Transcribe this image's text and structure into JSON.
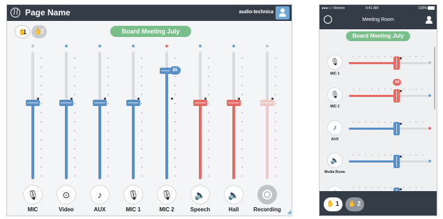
{
  "tablet": {
    "title": "Page Name",
    "brand": "audio-technica",
    "presets": [
      {
        "label": "1",
        "active": true,
        "icon": "hand-icon"
      },
      {
        "label": "2",
        "active": false,
        "icon": "hand-icon"
      }
    ],
    "meeting": "Board Meeting July",
    "channels": [
      {
        "label": "MIC",
        "icon": "microphone-icon",
        "glyph": "🎙",
        "color": "#5a8fc7",
        "led": "#c0c3c6",
        "level": 0.6,
        "active": true
      },
      {
        "label": "Video",
        "icon": "video-icon",
        "glyph": "⊙",
        "color": "#5a8fc7",
        "led": "#6ea6d6",
        "level": 0.6,
        "active": true
      },
      {
        "label": "AUX",
        "icon": "music-note-icon",
        "glyph": "♪",
        "color": "#5a8fc7",
        "led": "#6ea6d6",
        "level": 0.6,
        "active": true
      },
      {
        "label": "MIC 1",
        "icon": "microphone-icon",
        "glyph": "🎙",
        "color": "#5a8fc7",
        "led": "#6ea6d6",
        "level": 0.6,
        "active": true
      },
      {
        "label": "MIC 2",
        "icon": "microphone-icon",
        "glyph": "🎙",
        "color": "#5a8fc7",
        "led": "#e36d66",
        "level": 0.85,
        "active": true,
        "badge": "85"
      },
      {
        "label": "Speech",
        "icon": "speaker-icon",
        "glyph": "🔈",
        "color": "#e36d66",
        "led": "#6ea6d6",
        "level": 0.6,
        "active": true
      },
      {
        "label": "Hall",
        "icon": "speaker-icon",
        "glyph": "🔈",
        "color": "#e36d66",
        "led": "#6ea6d6",
        "level": 0.6,
        "active": true
      },
      {
        "label": "Recording",
        "icon": "record-icon",
        "glyph": "",
        "color": "#f0c9c6",
        "led": "#c0c3c6",
        "level": 0.6,
        "active": false
      }
    ]
  },
  "phone": {
    "status": {
      "carrier": "●●●○○ Verizon",
      "time": "9:41 AM",
      "battery": "100%"
    },
    "title": "Meeting Room",
    "meeting": "Board Meeting July",
    "channels": [
      {
        "label": "MIC 1",
        "icon": "microphone-icon",
        "glyph": "🎙",
        "color": "#e36d66",
        "led": "#c0c3c6",
        "level": 0.6
      },
      {
        "label": "MIC 2",
        "icon": "microphone-icon",
        "glyph": "🎙",
        "color": "#e36d66",
        "led": "#6ea6d6",
        "level": 0.6,
        "badge": "64"
      },
      {
        "label": "AUX",
        "icon": "music-note-icon",
        "glyph": "♪",
        "color": "#5a8fc7",
        "led": "#e36d66",
        "level": 0.6
      },
      {
        "label": "Media Room",
        "icon": "speaker-icon",
        "glyph": "🔈",
        "color": "#5a8fc7",
        "led": "#6ea6d6",
        "level": 0.6
      },
      {
        "label": "",
        "icon": "record-icon",
        "glyph": "◉",
        "color": "#5a8fc7",
        "led": "#6ea6d6",
        "level": 0.6
      }
    ],
    "presets": [
      {
        "label": "1",
        "active": true,
        "icon": "hand-icon"
      },
      {
        "label": "2",
        "active": false,
        "icon": "hand-icon"
      }
    ]
  }
}
